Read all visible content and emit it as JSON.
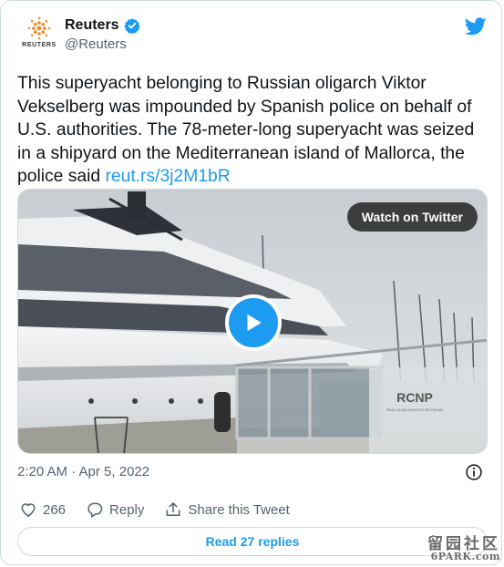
{
  "account": {
    "name": "Reuters",
    "handle": "@Reuters",
    "logo_text": "REUTERS",
    "verified": true,
    "logo_icon": "reuters-dots-logo"
  },
  "tweet": {
    "text": "This superyacht belonging to Russian oligarch Viktor Vekselberg was impounded by Spanish police on behalf of U.S. authorities. The 78-meter-long superyacht was seized in a shipyard on the Mediterranean island of Mallorca, the police said ",
    "link": "reut.rs/3j2M1bR",
    "timestamp": "2:20 AM · Apr 5, 2022"
  },
  "media": {
    "watch_label": "Watch on Twitter",
    "sign_text": "RCNP",
    "sign_subtext": "REAL CLUB NAUTICO DE PALMA"
  },
  "actions": {
    "like_count": "266",
    "reply_label": "Reply",
    "share_label": "Share this Tweet"
  },
  "replies_button": "Read 27 replies",
  "watermark": {
    "chinese": "留园社区",
    "site": "6PARK.com"
  },
  "colors": {
    "accent": "#1d9bf0",
    "secondary_text": "#536471",
    "border": "#cfd9de"
  }
}
